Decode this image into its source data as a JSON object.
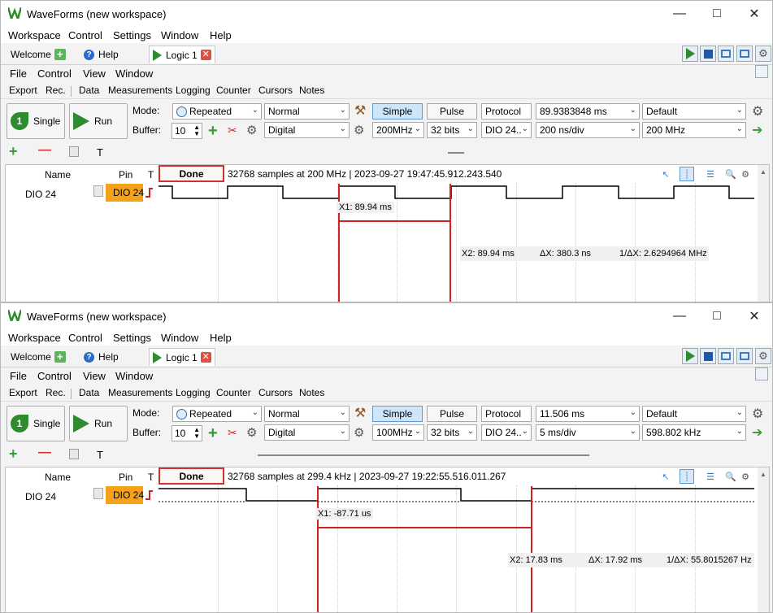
{
  "windows": [
    {
      "title": "WaveForms (new workspace)",
      "app_menu": [
        "Workspace",
        "Control",
        "Settings",
        "Window",
        "Help"
      ],
      "tabs": {
        "welcome": "Welcome",
        "help": "Help",
        "logic": "Logic 1"
      },
      "sub_menu": [
        "File",
        "Control",
        "View",
        "Window"
      ],
      "inst_menu": [
        "Export",
        "Rec.",
        "Data",
        "Measurements",
        "Logging",
        "Counter",
        "Cursors",
        "Notes"
      ],
      "single_label": "Single",
      "run_label": "Run",
      "mode_label": "Mode:",
      "buffer_label": "Buffer:",
      "mode_value": "Repeated",
      "buffer_value": "10",
      "normal_value": "Normal",
      "digital_value": "Digital",
      "simple_label": "Simple",
      "pulse_label": "Pulse",
      "protocol_label": "Protocol",
      "position_value": "89.9383848 ms",
      "default_value": "Default",
      "rate_value": "200MHz",
      "bits_value": "32 bits",
      "dio_value": "DIO 24..",
      "base_value": "200 ns/div",
      "freq_value": "200 MHz",
      "tool_t": "T",
      "hdr_name": "Name",
      "hdr_pin": "Pin",
      "hdr_t": "T",
      "done_label": "Done",
      "status_text": "32768 samples at 200 MHz | 2023-09-27 19:47:45.912.243.540",
      "channel_name": "DIO 24",
      "channel_pin": "DIO 24",
      "x1_label": "X1: 89.94 ms",
      "x2_label": "X2: 89.94 ms",
      "dx_label": "ΔX: 380.3 ns",
      "inv_dx_label": "1/ΔX: 2.6294964 MHz"
    },
    {
      "title": "WaveForms (new workspace)",
      "app_menu": [
        "Workspace",
        "Control",
        "Settings",
        "Window",
        "Help"
      ],
      "tabs": {
        "welcome": "Welcome",
        "help": "Help",
        "logic": "Logic 1"
      },
      "sub_menu": [
        "File",
        "Control",
        "View",
        "Window"
      ],
      "inst_menu": [
        "Export",
        "Rec.",
        "Data",
        "Measurements",
        "Logging",
        "Counter",
        "Cursors",
        "Notes"
      ],
      "single_label": "Single",
      "run_label": "Run",
      "mode_label": "Mode:",
      "buffer_label": "Buffer:",
      "mode_value": "Repeated",
      "buffer_value": "10",
      "normal_value": "Normal",
      "digital_value": "Digital",
      "simple_label": "Simple",
      "pulse_label": "Pulse",
      "protocol_label": "Protocol",
      "position_value": "11.506 ms",
      "default_value": "Default",
      "rate_value": "100MHz",
      "bits_value": "32 bits",
      "dio_value": "DIO 24..",
      "base_value": "5 ms/div",
      "freq_value": "598.802 kHz",
      "tool_t": "T",
      "hdr_name": "Name",
      "hdr_pin": "Pin",
      "hdr_t": "T",
      "done_label": "Done",
      "status_text": "32768 samples at 299.4 kHz | 2023-09-27 19:22:55.516.011.267",
      "channel_name": "DIO 24",
      "channel_pin": "DIO 24",
      "x1_label": "X1: -87.71 us",
      "x2_label": "X2: 17.83 ms",
      "dx_label": "ΔX: 17.92 ms",
      "inv_dx_label": "1/ΔX: 55.8015267 Hz"
    }
  ],
  "colors": {
    "cursor": "#d42020",
    "pin_bg": "#f5a219",
    "run_green": "#2e8b2e",
    "selected_blue": "#cfe5fa"
  },
  "icons": [
    "waveforms-logo-icon",
    "minimize-icon",
    "maximize-icon",
    "close-icon",
    "plus-icon",
    "help-icon",
    "logic-play-icon",
    "tab-close-icon",
    "run-icon",
    "stop-icon",
    "layout-icon",
    "gear-icon",
    "hammer-icon",
    "scissors-icon",
    "zoom-icon",
    "arrow-right-icon"
  ]
}
